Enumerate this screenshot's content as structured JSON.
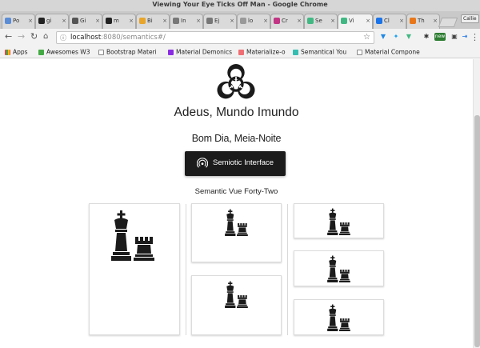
{
  "window": {
    "title": "Viewing Your Eye Ticks Off Man - Google Chrome"
  },
  "tabs": [
    {
      "label": "Po",
      "color": "#5b8dd6"
    },
    {
      "label": "gi",
      "color": "#222222"
    },
    {
      "label": "Gi",
      "color": "#555555"
    },
    {
      "label": "m",
      "color": "#222222"
    },
    {
      "label": "Bi",
      "color": "#e8a52a"
    },
    {
      "label": "In",
      "color": "#777777"
    },
    {
      "label": "Ej",
      "color": "#777777"
    },
    {
      "label": "lo",
      "color": "#999999"
    },
    {
      "label": "Cr",
      "color": "#c13584"
    },
    {
      "label": "Se",
      "color": "#41b883"
    },
    {
      "label": "Vi",
      "color": "#41b883"
    },
    {
      "label": "Cl",
      "color": "#1a73e8"
    },
    {
      "label": "Th",
      "color": "#e8771a"
    }
  ],
  "profile_label": "Callie",
  "toolbar": {
    "url_host": "localhost",
    "url_path": ":8080/semantics#/",
    "back_icon": "arrow-left-icon",
    "forward_icon": "arrow-right-icon",
    "reload_icon": "reload-icon",
    "home_icon": "home-icon",
    "ext_new_badge": "new"
  },
  "bookmarks": [
    {
      "label": "Apps",
      "color": "#e44"
    },
    {
      "label": "Awesomes W3",
      "color": "#4a4"
    },
    {
      "label": "Bootstrap Materi",
      "color": "#888"
    },
    {
      "label": "Material Demonics",
      "color": "#8a2be2"
    },
    {
      "label": "Materialize-o",
      "color": "#ee6e73"
    },
    {
      "label": "Semantical You",
      "color": "#35bdb2"
    },
    {
      "label": "Material Compone",
      "color": "#888"
    }
  ],
  "page": {
    "heading": "Adeus, Mundo Imundo",
    "subheading": "Bom Dia, Meia-Noite",
    "button_label": "Semiotic Interface",
    "section_label": "Semantic Vue Forty-Two",
    "colors": {
      "dark": "#1b1b1b",
      "card_border": "#dcdcdc"
    }
  }
}
